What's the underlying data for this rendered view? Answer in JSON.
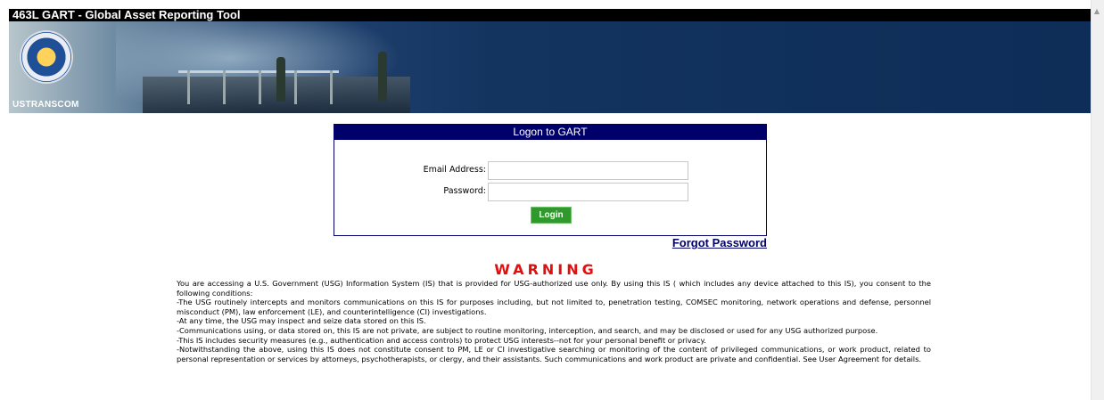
{
  "window": {
    "title": "463L GART - Global Asset Reporting Tool"
  },
  "banner": {
    "org_label": "USTRANSCOM"
  },
  "login": {
    "header": "Logon to GART",
    "email_label": "Email Address:",
    "email_value": "",
    "password_label": "Password:",
    "password_value": "",
    "login_button": "Login",
    "forgot_password": "Forgot Password"
  },
  "warning": {
    "title": "WARNING",
    "paragraphs": [
      "You are accessing a U.S. Government (USG) Information System (IS) that is provided for USG-authorized use only. By using this IS ( which includes any device attached to this IS), you consent to the following conditions:",
      "-The USG routinely intercepts and monitors communications on this IS for purposes including, but not limited to, penetration testing, COMSEC monitoring, network operations and defense, personnel misconduct (PM), law enforcement (LE), and counterintelligence (CI) investigations.",
      "-At any time, the USG may inspect and seize data stored on this IS.",
      "-Communications using, or data stored on, this IS are not private, are subject to routine monitoring, interception, and search, and may be disclosed or used for any USG authorized purpose.",
      "-This IS includes security measures (e.g., authentication and access controls) to protect USG interests--not for your personal benefit or privacy.",
      "-Notwithstanding the above, using this IS does not constitute consent to PM, LE or CI investigative searching or monitoring of the content of privileged communications, or work product, related to personal representation or services by attorneys, psychotherapists, or clergy, and their assistants. Such communications and work product are private and confidential. See User Agreement for details."
    ]
  },
  "colors": {
    "header_navy": "#00006b",
    "warning_red": "#e01010",
    "login_green": "#2f9a2b"
  },
  "icons": [
    "ustranscom-seal-icon",
    "scroll-up-arrow-icon"
  ]
}
